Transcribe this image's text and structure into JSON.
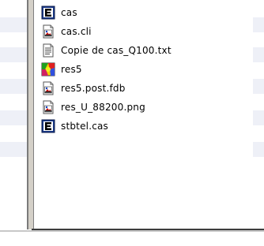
{
  "colors": {
    "frame_dark": "#7b7b7b",
    "frame_face": "#d4d0c8",
    "band": "#eef0f7",
    "text": "#000000"
  },
  "files": [
    {
      "name": "cas",
      "icon": "e-letter-icon"
    },
    {
      "name": "cas.cli",
      "icon": "image-file-icon"
    },
    {
      "name": "Copie de cas_Q100.txt",
      "icon": "text-file-icon"
    },
    {
      "name": "res5",
      "icon": "color-map-icon"
    },
    {
      "name": "res5.post.fdb",
      "icon": "image-file-icon"
    },
    {
      "name": "res_U_88200.png",
      "icon": "image-file-icon"
    },
    {
      "name": "stbtel.cas",
      "icon": "e-letter-icon"
    }
  ]
}
